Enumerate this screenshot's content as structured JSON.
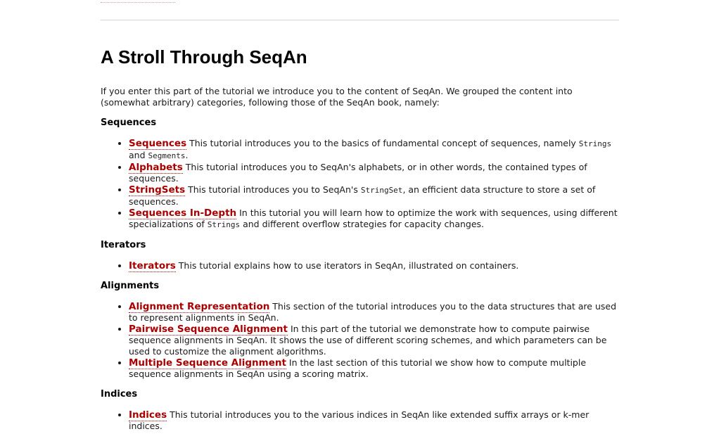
{
  "header": {
    "title": "A Stroll Through SeqAn"
  },
  "intro": "If you enter this part of the tutorial we introduce you to the content of SeqAn. We grouped the content into\n(somewhat arbitrary) categories, following those of the SeqAn book, namely:",
  "sections": {
    "sequences": {
      "heading": "Sequences",
      "items": [
        {
          "link": "Sequences",
          "t1": " This tutorial introduces you to the basics of fundamental concept of sequences, namely ",
          "c1": "Strings",
          "t2": " and ",
          "c2": "Segments",
          "t3": "."
        },
        {
          "link": "Alphabets",
          "t1": " This tutorial introduces you to SeqAn's alphabets, or in other words, the contained types of sequences."
        },
        {
          "link": "StringSets",
          "t1": " This tutorial introduces you to SeqAn's ",
          "c1": "StringSet",
          "t2": ", an efficient data structure to store a set of sequences."
        },
        {
          "link": "Sequences In-Depth",
          "t1": " In this tutorial you will learn how to optimize the work with sequences, using different specializations of ",
          "c1": "Strings",
          "t2": " and different overflow strategies for capacity changes."
        }
      ]
    },
    "iterators": {
      "heading": "Iterators",
      "items": [
        {
          "link": "Iterators",
          "t1": " This tutorial explains how to use iterators in SeqAn, illustrated on containers."
        }
      ]
    },
    "alignments": {
      "heading": "Alignments",
      "items": [
        {
          "link": "Alignment Representation",
          "t1": " This section of the tutorial introduces you to the data structures that are used to represent alignments in SeqAn."
        },
        {
          "link": "Pairwise Sequence Alignment",
          "t1": " In this part of the tutorial we demonstrate how to compute pairwise sequence alignments in SeqAn. It shows the use of different scoring schemes, and which parameters can be used to customize the alignment algorithms."
        },
        {
          "link": "Multiple Sequence Alignment",
          "t1": " In the last section of this tutorial we show how to compute multiple sequence alignments in SeqAn using a scoring matrix."
        }
      ]
    },
    "indices": {
      "heading": "Indices",
      "items": [
        {
          "link": "Indices",
          "t1": " This tutorial introduces you to the various indices in SeqAn like extended suffix arrays or k-mer indices."
        }
      ]
    }
  }
}
